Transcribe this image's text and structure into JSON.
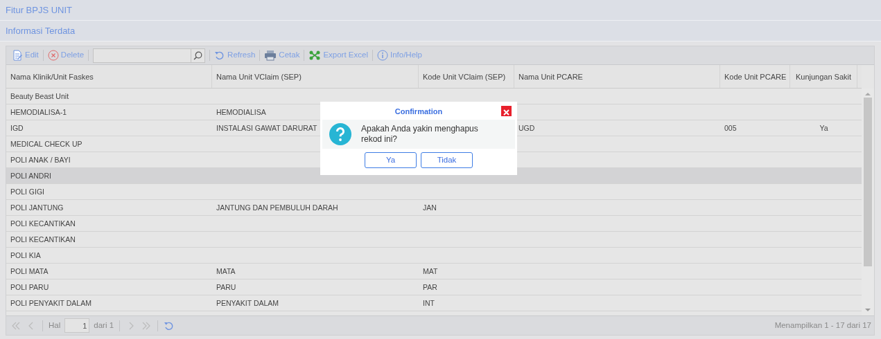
{
  "header": {
    "title": "Fitur BPJS UNIT",
    "subtitle": "Informasi Terdata"
  },
  "toolbar": {
    "buttons": [
      {
        "kind": "edit",
        "label": "Edit"
      },
      {
        "kind": "delete",
        "label": "Delete"
      },
      {
        "kind": "search"
      },
      {
        "kind": "refresh",
        "label": "Refresh"
      },
      {
        "kind": "print",
        "label": "Cetak"
      },
      {
        "kind": "excel",
        "label": "Export Excel"
      },
      {
        "kind": "info",
        "label": "Info/Help"
      }
    ]
  },
  "table": {
    "columns": [
      "Nama Klinik/Unit Faskes",
      "Nama Unit VClaim (SEP)",
      "Kode Unit VClaim (SEP)",
      "Nama Unit PCARE",
      "Kode Unit PCARE",
      "Kunjungan Sakit"
    ],
    "rows": [
      {
        "selected": false,
        "cells": {
          "0": "Beauty Beast Unit"
        }
      },
      {
        "selected": false,
        "cells": {
          "0": "HEMODIALISA-1",
          "1": "HEMODIALISA"
        }
      },
      {
        "selected": false,
        "cells": {
          "0": "IGD",
          "1": "INSTALASI GAWAT DARURAT",
          "3": "UGD",
          "4": "005",
          "5": "Ya"
        }
      },
      {
        "selected": false,
        "cells": {
          "0": "MEDICAL CHECK UP"
        }
      },
      {
        "selected": false,
        "cells": {
          "0": "POLI ANAK / BAYI"
        }
      },
      {
        "selected": true,
        "cells": {
          "0": "POLI ANDRI"
        }
      },
      {
        "selected": false,
        "cells": {
          "0": "POLI GIGI"
        }
      },
      {
        "selected": false,
        "cells": {
          "0": "POLI JANTUNG",
          "1": "JANTUNG DAN PEMBULUH DARAH",
          "2": "JAN"
        }
      },
      {
        "selected": false,
        "cells": {
          "0": "POLI KECANTIKAN"
        }
      },
      {
        "selected": false,
        "cells": {
          "0": "POLI KECANTIKAN"
        }
      },
      {
        "selected": false,
        "cells": {
          "0": "POLI KIA"
        }
      },
      {
        "selected": false,
        "cells": {
          "0": "POLI MATA",
          "1": "MATA",
          "2": "MAT"
        }
      },
      {
        "selected": false,
        "cells": {
          "0": "POLI PARU",
          "1": "PARU",
          "2": "PAR"
        }
      },
      {
        "selected": false,
        "cells": {
          "0": "POLI PENYAKIT DALAM",
          "1": "PENYAKIT DALAM",
          "2": "INT"
        }
      }
    ]
  },
  "pager": {
    "page_label": "Hal",
    "page": "1",
    "of": "dari 1",
    "summary": "Menampilkan 1 - 17 dari 17"
  },
  "dialog": {
    "title": "Confirmation",
    "message": "Apakah Anda yakin menghapus rekod ini?",
    "buttons": [
      "Ya",
      "Tidak"
    ]
  }
}
